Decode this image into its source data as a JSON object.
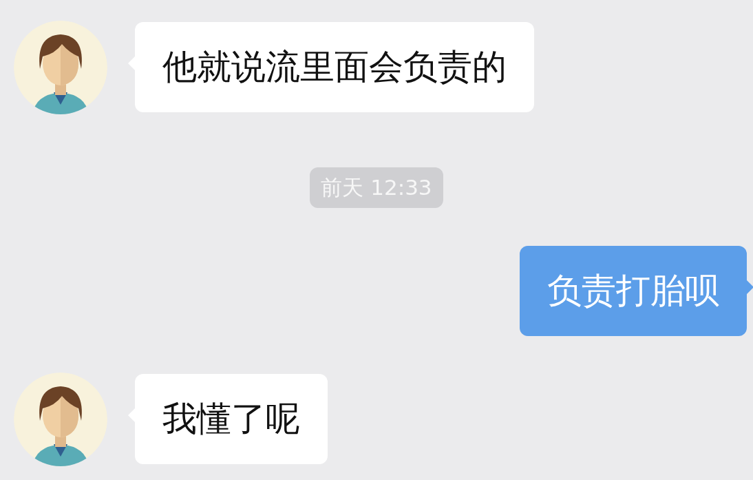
{
  "messages": [
    {
      "kind": "incoming",
      "text": "他就说流里面会负责的"
    },
    {
      "kind": "time",
      "text": "前天 12:33"
    },
    {
      "kind": "outgoing",
      "text": "负责打胎呗"
    },
    {
      "kind": "incoming",
      "text": "我懂了呢"
    }
  ]
}
